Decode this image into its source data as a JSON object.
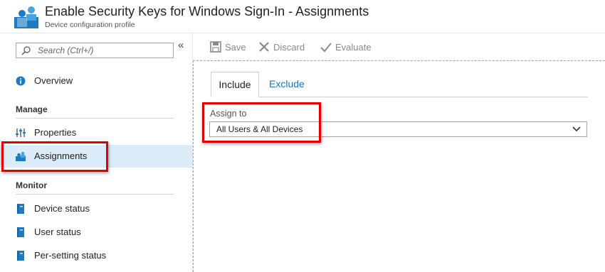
{
  "header": {
    "title": "Enable Security Keys for Windows Sign-In - Assignments",
    "subtitle": "Device configuration profile",
    "icon": "assignments-people-icon"
  },
  "sidebar": {
    "search_placeholder": "Search (Ctrl+/)",
    "collapse_glyph": "«",
    "overview": {
      "label": "Overview",
      "icon": "info-icon"
    },
    "sections": [
      {
        "title": "Manage",
        "items": [
          {
            "label": "Properties",
            "icon": "properties-sliders-icon"
          },
          {
            "label": "Assignments",
            "icon": "assignments-people-icon",
            "active": true
          }
        ]
      },
      {
        "title": "Monitor",
        "items": [
          {
            "label": "Device status",
            "icon": "report-book-icon"
          },
          {
            "label": "User status",
            "icon": "report-book-icon"
          },
          {
            "label": "Per-setting status",
            "icon": "report-book-icon"
          }
        ]
      }
    ]
  },
  "toolbar": {
    "save": "Save",
    "discard": "Discard",
    "evaluate": "Evaluate"
  },
  "tabs": {
    "include": "Include",
    "exclude": "Exclude"
  },
  "assign": {
    "label": "Assign to",
    "selected": "All Users & All Devices"
  },
  "colors": {
    "accent": "#1a73c8",
    "active_bg": "#dcebf8",
    "highlight": "#e00000",
    "icon_blue": "#1f7bc1"
  }
}
